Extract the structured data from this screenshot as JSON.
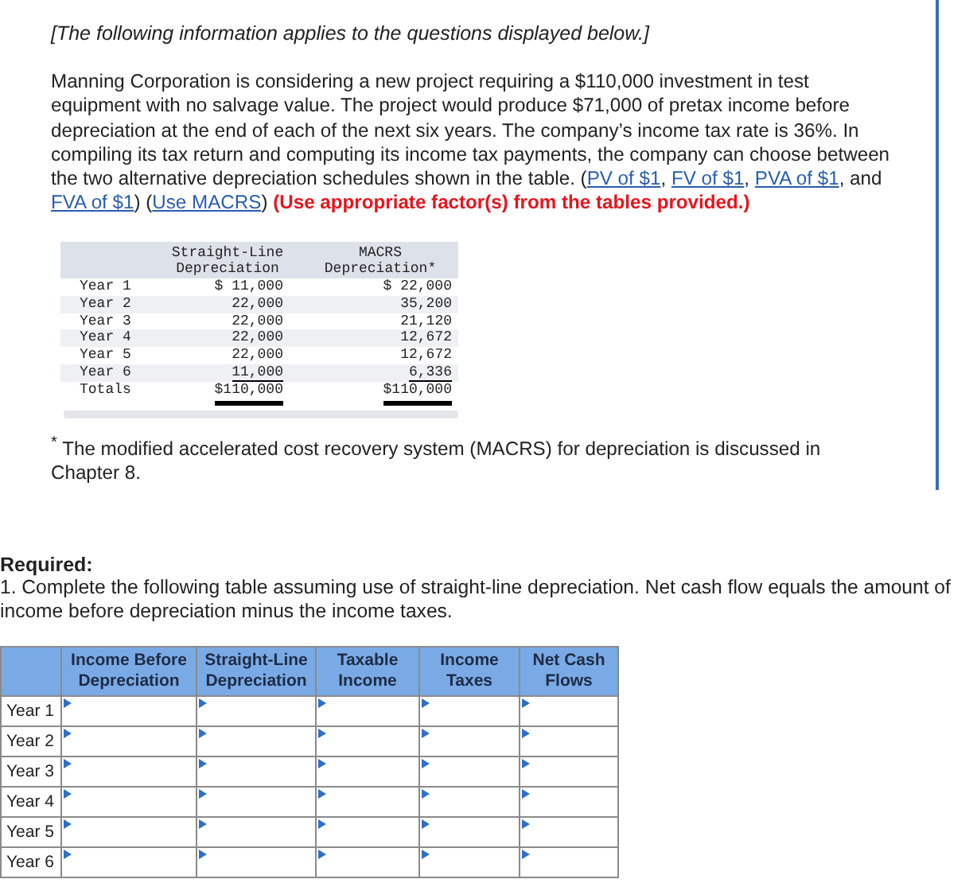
{
  "intro": "[The following information applies to the questions displayed below.]",
  "paragraph": [
    {
      "kind": "text",
      "text": "Manning Corporation is considering a new project requiring a $110,000 investment in test equipment with no salvage value. The project would produce $71,000 of pretax income before depreciation at the end of each of the next six years. The company’s income tax rate is 36%. In compiling its tax return and computing its income tax payments, the company can choose between the two alternative depreciation schedules shown in the table. ("
    },
    {
      "kind": "link",
      "text": "PV of $1"
    },
    {
      "kind": "text",
      "text": ", "
    },
    {
      "kind": "link",
      "text": "FV of $1"
    },
    {
      "kind": "text",
      "text": ", "
    },
    {
      "kind": "link",
      "text": "PVA of $1"
    },
    {
      "kind": "text",
      "text": ", and "
    },
    {
      "kind": "link",
      "text": "FVA of $1"
    },
    {
      "kind": "text",
      "text": ") ("
    },
    {
      "kind": "link",
      "text": "Use MACRS"
    },
    {
      "kind": "text",
      "text": ") "
    },
    {
      "kind": "alert",
      "text": "(Use appropriate factor(s) from the tables provided.)"
    }
  ],
  "depreciation_table": {
    "columns": [
      [
        "Straight-Line",
        "Depreciation"
      ],
      [
        "MACRS",
        "Depreciation*"
      ]
    ],
    "rows": [
      {
        "label": "Year 1",
        "values": [
          "$ 11,000",
          "$ 22,000"
        ]
      },
      {
        "label": "Year 2",
        "values": [
          "22,000",
          "35,200"
        ]
      },
      {
        "label": "Year 3",
        "values": [
          "22,000",
          "21,120"
        ]
      },
      {
        "label": "Year 4",
        "values": [
          "22,000",
          "12,672"
        ]
      },
      {
        "label": "Year 5",
        "values": [
          "22,000",
          "12,672"
        ]
      },
      {
        "label": "Year 6",
        "values": [
          "11,000",
          "6,336"
        ]
      }
    ],
    "totals": {
      "label": "Totals",
      "values": [
        "$110,000",
        "$110,000"
      ]
    }
  },
  "footnote": "$^{*}$ The modified accelerated cost recovery system (MACRS) for depreciation is discussed in Chapter 8.",
  "required_heading": "Required:",
  "question": "1. Complete the following table assuming use of straight-line depreciation. Net cash flow equals the amount of income before depreciation minus the income taxes.",
  "answer_table": {
    "columns": [
      [
        "Income Before",
        "Depreciation"
      ],
      [
        "Straight-Line",
        "Depreciation"
      ],
      [
        "Taxable",
        "Income"
      ],
      [
        "Income",
        "Taxes"
      ],
      [
        "Net Cash",
        "Flows"
      ]
    ],
    "rows": [
      "Year 1",
      "Year 2",
      "Year 3",
      "Year 4",
      "Year 5",
      "Year 6"
    ]
  }
}
